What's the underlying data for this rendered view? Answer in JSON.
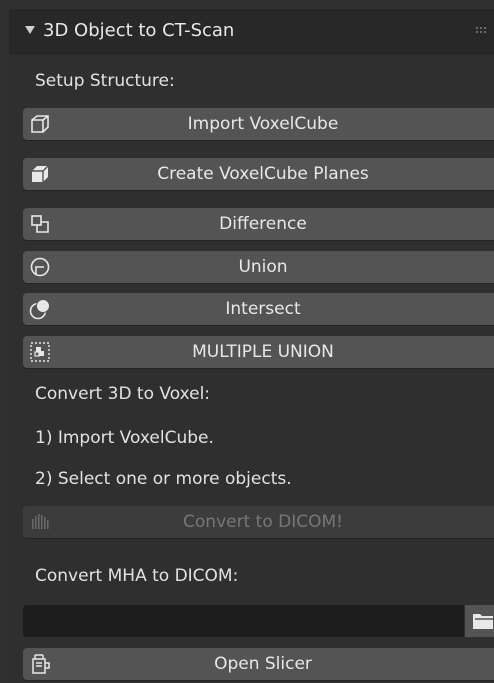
{
  "panel": {
    "title": "3D Object to CT-Scan",
    "collapse_icon": "triangle-down-icon",
    "grip_icon": "drag-grip-icon"
  },
  "setup": {
    "heading": "Setup Structure:",
    "buttons": [
      {
        "label": "Import VoxelCube",
        "icon": "cube-outline-icon"
      },
      {
        "label": "Create VoxelCube Planes",
        "icon": "cube-solid-icon"
      },
      {
        "label": "Difference",
        "icon": "boolean-difference-icon"
      },
      {
        "label": "Union",
        "icon": "boolean-union-icon"
      },
      {
        "label": "Intersect",
        "icon": "boolean-intersect-icon"
      },
      {
        "label": "MULTIPLE UNION",
        "icon": "multiple-union-icon"
      }
    ]
  },
  "convert_voxel": {
    "heading": "Convert 3D to Voxel:",
    "step1": "1) Import VoxelCube.",
    "step2": "2) Select one or more objects.",
    "convert_button": {
      "label": "Convert to DICOM!",
      "icon": "volume-icon",
      "enabled": false
    }
  },
  "convert_mha": {
    "heading": "Convert MHA to DICOM:",
    "path_value": "",
    "browse_icon": "folder-icon"
  },
  "slicer": {
    "button_label": "Open Slicer",
    "icon": "slicer-icon"
  },
  "colors": {
    "background": "#303030",
    "header": "#282828",
    "button": "#545454",
    "button_disabled": "#3c3c3c",
    "text": "#e6e6e6",
    "text_disabled": "#777777",
    "field": "#1d1d1d"
  }
}
